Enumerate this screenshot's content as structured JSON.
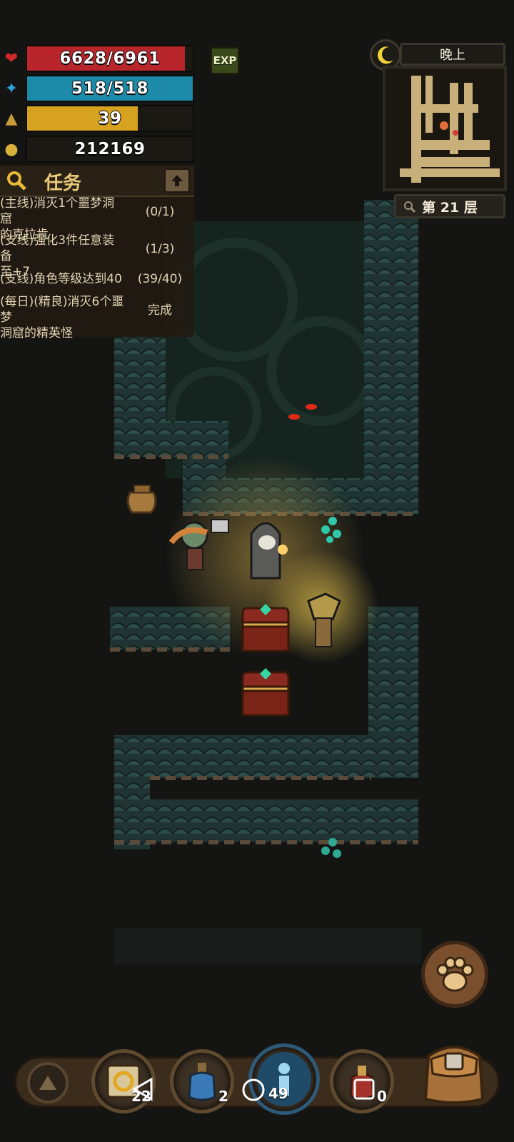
{
  "stats": {
    "hp": {
      "text": "6628/6961",
      "fraction": 0.952
    },
    "mp": {
      "text": "518/518",
      "fraction": 1.0
    },
    "level": {
      "text": "39",
      "fraction": 0.67
    },
    "gold": {
      "text": "212169"
    },
    "exp_label": "EXP"
  },
  "quests": {
    "title": "任务",
    "items": [
      {
        "text": "(主线)消灭1个噩梦洞窟的克拉肯",
        "line1": "(主线)消灭1个噩梦洞窟",
        "line2": "的克拉肯",
        "progress": "(0/1)"
      },
      {
        "text": "(支线)强化3件任意装备至+7",
        "line1": "(支线)强化3件任意装备",
        "line2": "至+7",
        "progress": "(1/3)"
      },
      {
        "text": "(支线)角色等级达到40",
        "line1": "(支线)角色等级达到40",
        "line2": "",
        "progress": "(39/40)"
      },
      {
        "text": "(每日)(精良)消灭6个噩梦洞窟的精英怪",
        "line1": "(每日)(精良)消灭6个噩梦",
        "line2": "洞窟的精英怪",
        "progress": "完成"
      }
    ]
  },
  "map": {
    "time_of_day": "晚上",
    "floor": "第 21 层"
  },
  "hotbar": {
    "scroll_count": "22",
    "potion_count": "2",
    "skill_count": "49",
    "item_count": "0"
  },
  "colors": {
    "hp": "#b8252a",
    "mp": "#1c8aa8",
    "level": "#d6a21f",
    "panel": "#211a11",
    "accent_gold": "#e9c878"
  },
  "icons": [
    "heart-icon",
    "mana-icon",
    "level-icon",
    "gold-icon",
    "search-icon",
    "collapse-arrow-icon",
    "moon-icon",
    "zoom-icon",
    "paw-icon",
    "backpack-icon",
    "up-arrow-icon",
    "scroll-icon",
    "potion-icon",
    "skill-icon",
    "food-icon"
  ]
}
